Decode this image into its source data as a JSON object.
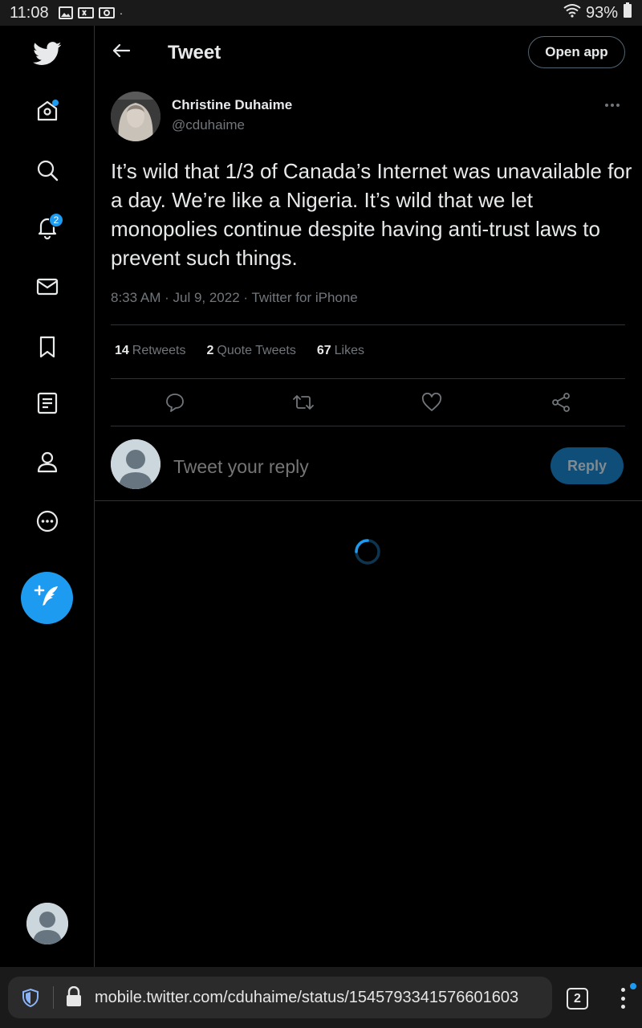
{
  "status_bar": {
    "time": "11:08",
    "battery": "93%"
  },
  "header": {
    "title": "Tweet",
    "open_app": "Open app"
  },
  "sidebar": {
    "notifications_badge": "2"
  },
  "tweet": {
    "author_name": "Christine Duhaime",
    "author_handle": "@cduhaime",
    "text": "It’s wild that 1/3 of Canada’s Internet was unavailable for a day. We’re like a Nigeria. It’s wild that we let monopolies continue despite having anti-trust laws to prevent such things.",
    "time": "8:33 AM",
    "date": "Jul 9, 2022",
    "source": "Twitter for iPhone",
    "retweets_count": "14",
    "retweets_label": "Retweets",
    "quotes_count": "2",
    "quotes_label": "Quote Tweets",
    "likes_count": "67",
    "likes_label": "Likes"
  },
  "reply": {
    "placeholder": "Tweet your reply",
    "button": "Reply"
  },
  "browser": {
    "url": "mobile.twitter.com/cduhaime/status/1545793341576601603",
    "tab_count": "2"
  },
  "colors": {
    "accent": "#1d9bf0",
    "background": "#000000",
    "muted_text": "#71767b",
    "border": "#2f3336"
  }
}
